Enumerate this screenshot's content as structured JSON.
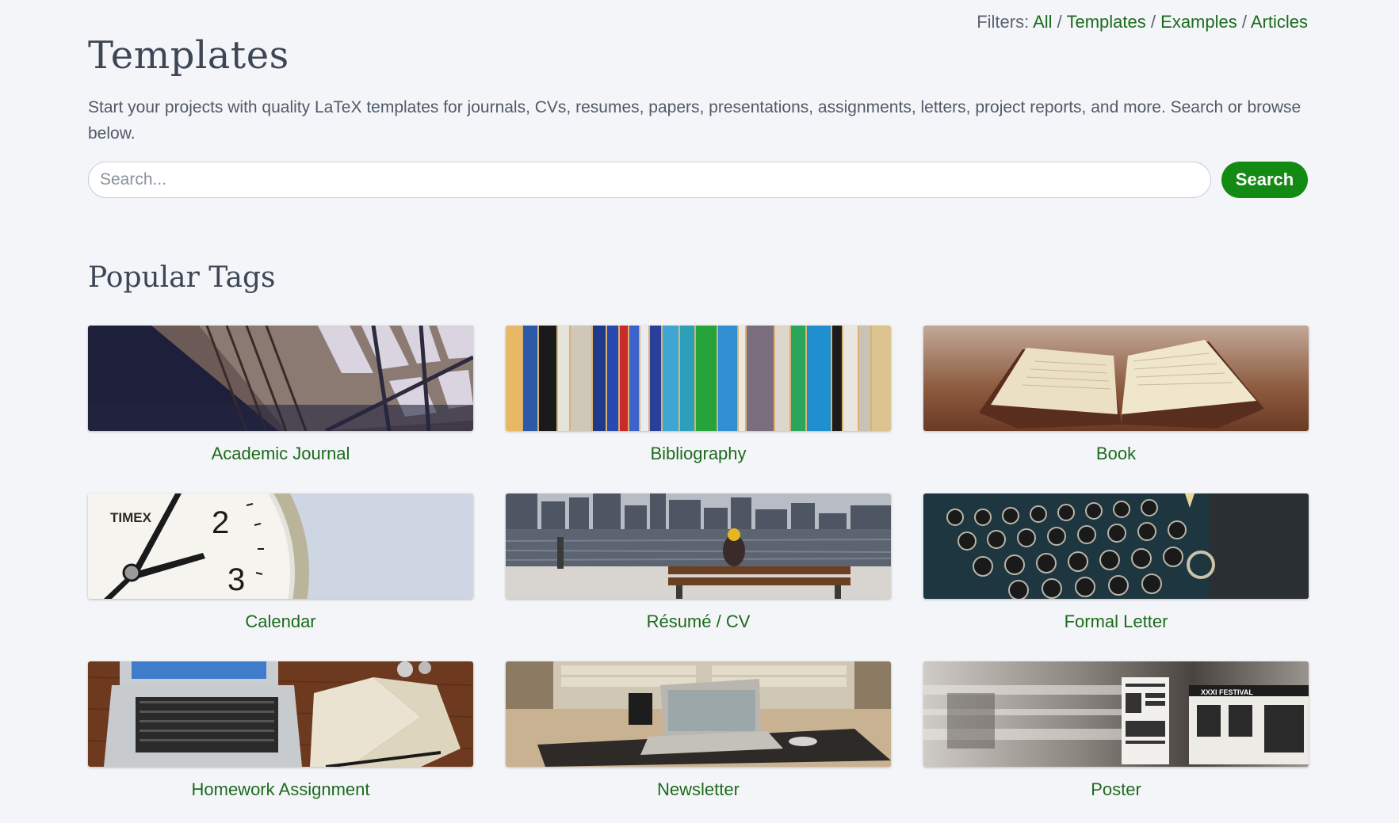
{
  "filters": {
    "prefix": "Filters:",
    "items": [
      "All",
      "Templates",
      "Examples",
      "Articles"
    ],
    "separator": "/"
  },
  "page_title": "Templates",
  "lead": "Start your projects with quality LaTeX templates for journals, CVs, resumes, papers, presentations, assignments, letters, project reports, and more. Search or browse below.",
  "search": {
    "placeholder": "Search...",
    "value": "",
    "button_label": "Search"
  },
  "popular_tags": {
    "heading": "Popular Tags",
    "tags": [
      {
        "label": "Academic Journal",
        "image": "library-bookshelves"
      },
      {
        "label": "Bibliography",
        "image": "book-spines"
      },
      {
        "label": "Book",
        "image": "open-book"
      },
      {
        "label": "Calendar",
        "image": "clock-face"
      },
      {
        "label": "Résumé / CV",
        "image": "city-bench"
      },
      {
        "label": "Formal Letter",
        "image": "typewriter"
      },
      {
        "label": "Homework Assignment",
        "image": "laptop-notebook"
      },
      {
        "label": "Newsletter",
        "image": "desk-laptop"
      },
      {
        "label": "Poster",
        "image": "blurred-posters"
      }
    ]
  },
  "colors": {
    "background": "#f4f5f9",
    "link": "#1c6b1c",
    "button": "#138a13",
    "heading": "#3d4654"
  }
}
